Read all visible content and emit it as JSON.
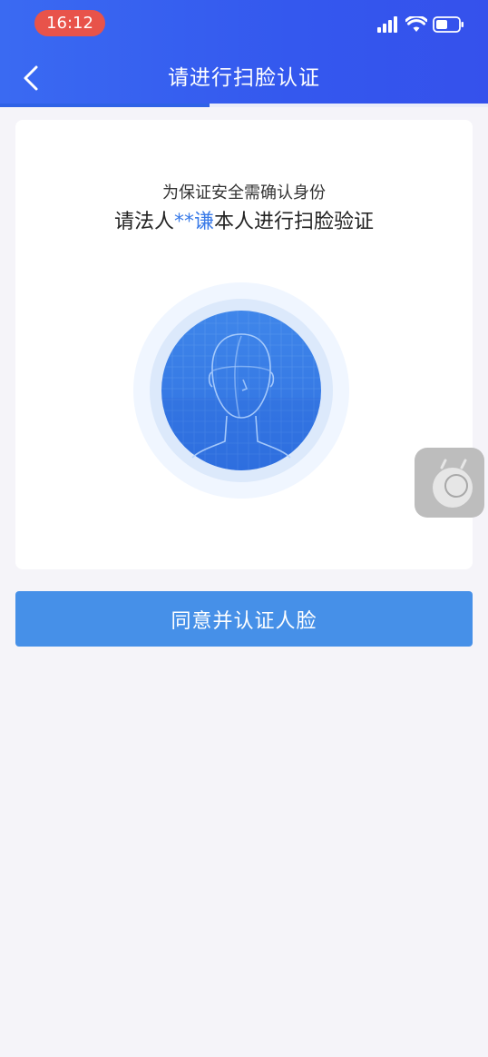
{
  "status_bar": {
    "time": "16:12"
  },
  "header": {
    "title": "请进行扫脸认证",
    "progress_fraction": 0.43
  },
  "card": {
    "subtitle": "为保证安全需确认身份",
    "main_prefix": "请法人",
    "main_highlight": "**谦",
    "main_suffix": "本人进行扫脸验证"
  },
  "agree_button": {
    "label": "同意并认证人脸"
  },
  "colors": {
    "header_blue": "#3458ee",
    "highlight_blue": "#3a7be8",
    "button_blue": "#4690e8",
    "time_pill_red": "#e8534a"
  },
  "icons": [
    "signal-icon",
    "wifi-icon",
    "battery-icon",
    "back-arrow-icon",
    "face-scan-icon",
    "floating-assistant-icon"
  ]
}
